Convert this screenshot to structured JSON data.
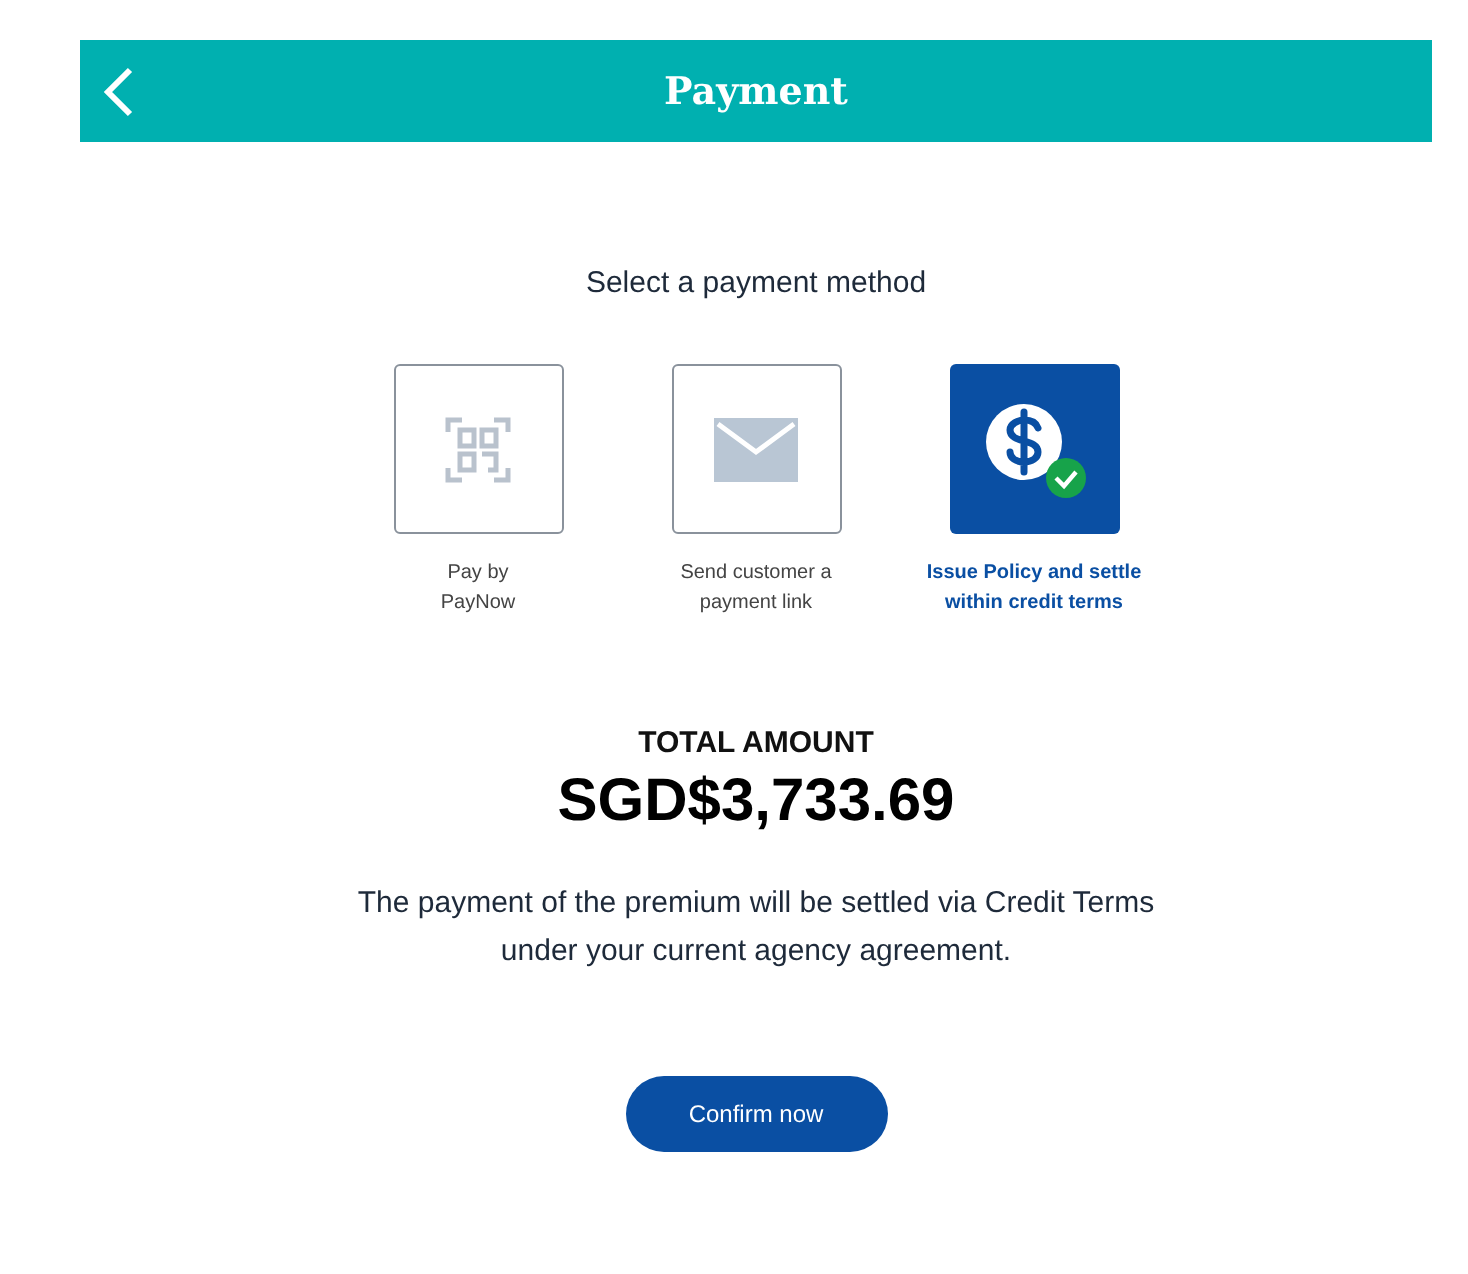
{
  "header": {
    "title": "Payment"
  },
  "prompt": "Select a payment method",
  "methods": [
    {
      "kind": "qr",
      "label": "Pay by\nPayNow",
      "selected": false
    },
    {
      "kind": "email",
      "label": "Send customer a\npayment link",
      "selected": false
    },
    {
      "kind": "dollar",
      "label": "Issue Policy and settle\nwithin credit terms",
      "selected": true
    }
  ],
  "total": {
    "label": "TOTAL AMOUNT",
    "amount": "SGD$3,733.69"
  },
  "note": "The payment of the premium will be settled via Credit Terms\nunder your current agency agreement.",
  "button": "Confirm now"
}
